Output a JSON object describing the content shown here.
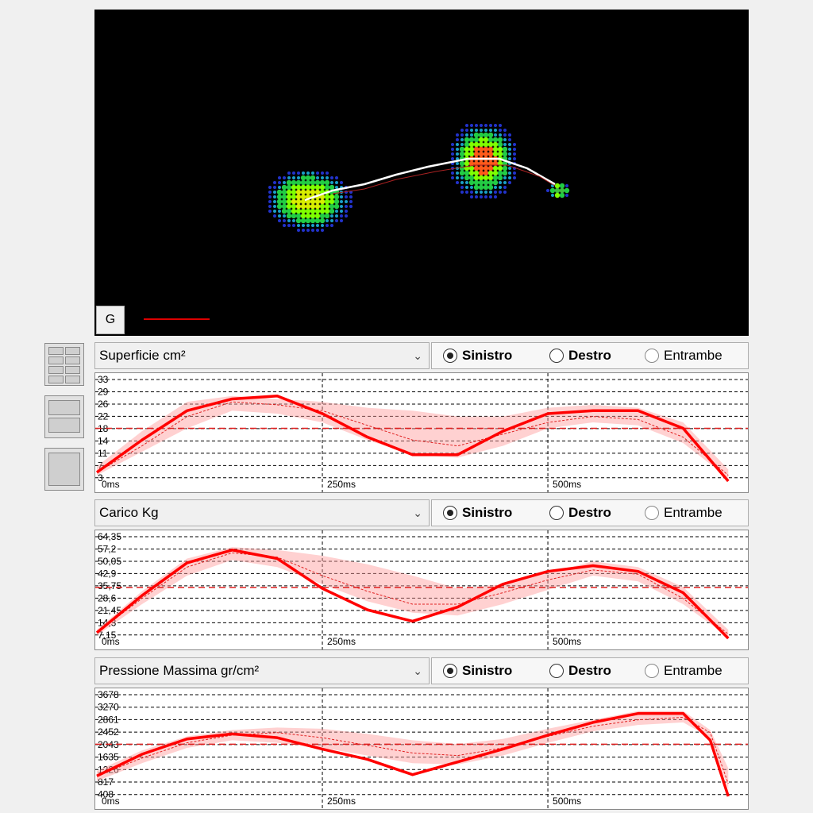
{
  "heatmap": {
    "g_button_label": "G",
    "colors": {
      "background": "#000000",
      "trajectory": "#ffffff",
      "marker_line": "#dd0000"
    }
  },
  "layout_buttons": [
    "grid-4-icon",
    "split-2-icon",
    "single-icon"
  ],
  "charts": [
    {
      "select_label": "Superficie cm²",
      "radios": [
        {
          "label": "Sinistro",
          "checked": true
        },
        {
          "label": "Destro",
          "checked": false
        },
        {
          "label": "Entrambe",
          "checked": false
        }
      ],
      "y_ticks": [
        "33",
        "29",
        "26",
        "22",
        "18",
        "14",
        "11",
        "7",
        "3"
      ],
      "x_ticks": [
        "0ms",
        "250ms",
        "500ms"
      ],
      "mean_line": 18
    },
    {
      "select_label": "Carico Kg",
      "radios": [
        {
          "label": "Sinistro",
          "checked": true
        },
        {
          "label": "Destro",
          "checked": false
        },
        {
          "label": "Entrambe",
          "checked": false
        }
      ],
      "y_ticks": [
        "64,35",
        "57,2",
        "50,05",
        "42,9",
        "35,75",
        "28,6",
        "21,45",
        "14,3",
        "7,15"
      ],
      "x_ticks": [
        "0ms",
        "250ms",
        "500ms"
      ],
      "mean_line": 35.75
    },
    {
      "select_label": "Pressione Massima gr/cm²",
      "radios": [
        {
          "label": "Sinistro",
          "checked": true
        },
        {
          "label": "Destro",
          "checked": false
        },
        {
          "label": "Entrambe",
          "checked": false
        }
      ],
      "y_ticks": [
        "3678",
        "3270",
        "2861",
        "2452",
        "2043",
        "1635",
        "1226",
        "817",
        "408"
      ],
      "x_ticks": [
        "0ms",
        "250ms",
        "500ms"
      ],
      "mean_line": 2043
    }
  ],
  "chart_data": [
    {
      "type": "line",
      "x": [
        0,
        50,
        100,
        150,
        200,
        250,
        300,
        350,
        400,
        450,
        500,
        550,
        600,
        650,
        700
      ],
      "series": [
        {
          "values": [
            3,
            14,
            24,
            28,
            29,
            23,
            15,
            9,
            9,
            17,
            23,
            24,
            24,
            18,
            0
          ]
        },
        {
          "values": [
            3,
            12,
            22,
            27,
            26,
            24,
            19,
            14,
            12,
            16,
            20,
            22,
            21,
            15,
            2
          ]
        }
      ],
      "band": {
        "lower": [
          2,
          10,
          18,
          24,
          23,
          20,
          14,
          9,
          8,
          12,
          18,
          20,
          19,
          13,
          1
        ],
        "upper": [
          5,
          17,
          27,
          29,
          28,
          27,
          25,
          24,
          22,
          22,
          25,
          26,
          25,
          20,
          4
        ]
      },
      "xlim": [
        0,
        720
      ],
      "ylim": [
        0,
        33
      ],
      "mean": 18
    },
    {
      "type": "line",
      "x": [
        0,
        50,
        100,
        150,
        200,
        250,
        300,
        350,
        400,
        450,
        500,
        550,
        600,
        650,
        700
      ],
      "series": [
        {
          "values": [
            4,
            30,
            53,
            62,
            56,
            35,
            20,
            12,
            22,
            38,
            47,
            51,
            47,
            32,
            0
          ]
        },
        {
          "values": [
            4,
            28,
            50,
            60,
            57,
            44,
            33,
            24,
            24,
            32,
            41,
            48,
            45,
            28,
            3
          ]
        }
      ],
      "band": {
        "lower": [
          2,
          24,
          44,
          55,
          50,
          38,
          26,
          18,
          16,
          24,
          34,
          44,
          40,
          24,
          1
        ],
        "upper": [
          6,
          33,
          56,
          64,
          62,
          58,
          52,
          44,
          35,
          38,
          46,
          54,
          50,
          36,
          6
        ]
      },
      "xlim": [
        0,
        720
      ],
      "ylim": [
        0,
        68
      ],
      "mean": 35.75
    },
    {
      "type": "line",
      "x": [
        0,
        50,
        100,
        150,
        200,
        250,
        300,
        350,
        400,
        450,
        500,
        550,
        600,
        650,
        680,
        700
      ],
      "series": [
        {
          "values": [
            800,
            1650,
            2250,
            2450,
            2300,
            1850,
            1450,
            850,
            1350,
            1850,
            2400,
            2900,
            3250,
            3250,
            2200,
            0
          ]
        },
        {
          "values": [
            800,
            1500,
            2100,
            2400,
            2500,
            2300,
            2000,
            1700,
            1600,
            1900,
            2350,
            2750,
            3000,
            3100,
            2500,
            500
          ]
        }
      ],
      "band": {
        "lower": [
          600,
          1300,
          1900,
          2200,
          2100,
          1900,
          1600,
          1300,
          1250,
          1600,
          2100,
          2550,
          2800,
          2900,
          2300,
          300
        ],
        "upper": [
          1000,
          1800,
          2350,
          2600,
          2700,
          2650,
          2450,
          2200,
          2050,
          2250,
          2650,
          3000,
          3350,
          3350,
          2600,
          1100
        ]
      },
      "xlim": [
        0,
        720
      ],
      "ylim": [
        0,
        3800
      ],
      "mean": 2043
    }
  ]
}
